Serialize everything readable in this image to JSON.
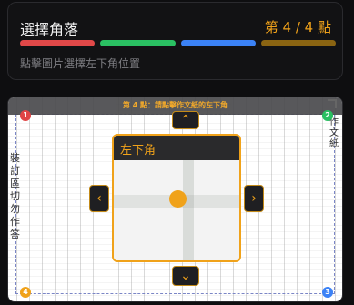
{
  "card": {
    "title": "選擇角落",
    "step": "第 4 / 4 點",
    "hint": "點擊圖片選擇左下角位置",
    "progress_colors": [
      "#e04848",
      "#2ac062",
      "#3b82f6",
      "#8a6412"
    ]
  },
  "viewer": {
    "instruction": "第 4 點：請點擊作文紙的左下角",
    "zoom_title": "左下角",
    "markers": [
      "1",
      "2",
      "3",
      "4"
    ],
    "side_text_left": "裝訂區切勿作答",
    "side_text_right": "作文紙"
  },
  "icons": {
    "up": "chevron-up-icon",
    "down": "chevron-down-icon",
    "left": "chevron-left-icon",
    "right": "chevron-right-icon"
  }
}
